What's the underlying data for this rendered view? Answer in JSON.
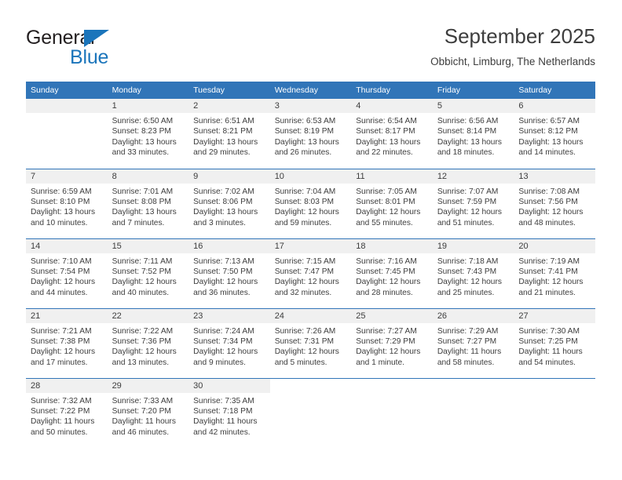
{
  "brand": {
    "name_dark": "General",
    "name_blue": "Blue",
    "accent_color": "#1b75bb"
  },
  "header": {
    "title": "September 2025",
    "subtitle": "Obbicht, Limburg, The Netherlands"
  },
  "theme": {
    "header_row_bg": "#3175b8",
    "daynum_bg": "#f0f0f0",
    "text_color": "#3d3d3d",
    "week_divider": "#3175b8"
  },
  "weekdays": [
    "Sunday",
    "Monday",
    "Tuesday",
    "Wednesday",
    "Thursday",
    "Friday",
    "Saturday"
  ],
  "weeks": [
    [
      {
        "day": "",
        "sunrise": "",
        "sunset": "",
        "daylight_1": "",
        "daylight_2": ""
      },
      {
        "day": "1",
        "sunrise": "Sunrise: 6:50 AM",
        "sunset": "Sunset: 8:23 PM",
        "daylight_1": "Daylight: 13 hours",
        "daylight_2": "and 33 minutes."
      },
      {
        "day": "2",
        "sunrise": "Sunrise: 6:51 AM",
        "sunset": "Sunset: 8:21 PM",
        "daylight_1": "Daylight: 13 hours",
        "daylight_2": "and 29 minutes."
      },
      {
        "day": "3",
        "sunrise": "Sunrise: 6:53 AM",
        "sunset": "Sunset: 8:19 PM",
        "daylight_1": "Daylight: 13 hours",
        "daylight_2": "and 26 minutes."
      },
      {
        "day": "4",
        "sunrise": "Sunrise: 6:54 AM",
        "sunset": "Sunset: 8:17 PM",
        "daylight_1": "Daylight: 13 hours",
        "daylight_2": "and 22 minutes."
      },
      {
        "day": "5",
        "sunrise": "Sunrise: 6:56 AM",
        "sunset": "Sunset: 8:14 PM",
        "daylight_1": "Daylight: 13 hours",
        "daylight_2": "and 18 minutes."
      },
      {
        "day": "6",
        "sunrise": "Sunrise: 6:57 AM",
        "sunset": "Sunset: 8:12 PM",
        "daylight_1": "Daylight: 13 hours",
        "daylight_2": "and 14 minutes."
      }
    ],
    [
      {
        "day": "7",
        "sunrise": "Sunrise: 6:59 AM",
        "sunset": "Sunset: 8:10 PM",
        "daylight_1": "Daylight: 13 hours",
        "daylight_2": "and 10 minutes."
      },
      {
        "day": "8",
        "sunrise": "Sunrise: 7:01 AM",
        "sunset": "Sunset: 8:08 PM",
        "daylight_1": "Daylight: 13 hours",
        "daylight_2": "and 7 minutes."
      },
      {
        "day": "9",
        "sunrise": "Sunrise: 7:02 AM",
        "sunset": "Sunset: 8:06 PM",
        "daylight_1": "Daylight: 13 hours",
        "daylight_2": "and 3 minutes."
      },
      {
        "day": "10",
        "sunrise": "Sunrise: 7:04 AM",
        "sunset": "Sunset: 8:03 PM",
        "daylight_1": "Daylight: 12 hours",
        "daylight_2": "and 59 minutes."
      },
      {
        "day": "11",
        "sunrise": "Sunrise: 7:05 AM",
        "sunset": "Sunset: 8:01 PM",
        "daylight_1": "Daylight: 12 hours",
        "daylight_2": "and 55 minutes."
      },
      {
        "day": "12",
        "sunrise": "Sunrise: 7:07 AM",
        "sunset": "Sunset: 7:59 PM",
        "daylight_1": "Daylight: 12 hours",
        "daylight_2": "and 51 minutes."
      },
      {
        "day": "13",
        "sunrise": "Sunrise: 7:08 AM",
        "sunset": "Sunset: 7:56 PM",
        "daylight_1": "Daylight: 12 hours",
        "daylight_2": "and 48 minutes."
      }
    ],
    [
      {
        "day": "14",
        "sunrise": "Sunrise: 7:10 AM",
        "sunset": "Sunset: 7:54 PM",
        "daylight_1": "Daylight: 12 hours",
        "daylight_2": "and 44 minutes."
      },
      {
        "day": "15",
        "sunrise": "Sunrise: 7:11 AM",
        "sunset": "Sunset: 7:52 PM",
        "daylight_1": "Daylight: 12 hours",
        "daylight_2": "and 40 minutes."
      },
      {
        "day": "16",
        "sunrise": "Sunrise: 7:13 AM",
        "sunset": "Sunset: 7:50 PM",
        "daylight_1": "Daylight: 12 hours",
        "daylight_2": "and 36 minutes."
      },
      {
        "day": "17",
        "sunrise": "Sunrise: 7:15 AM",
        "sunset": "Sunset: 7:47 PM",
        "daylight_1": "Daylight: 12 hours",
        "daylight_2": "and 32 minutes."
      },
      {
        "day": "18",
        "sunrise": "Sunrise: 7:16 AM",
        "sunset": "Sunset: 7:45 PM",
        "daylight_1": "Daylight: 12 hours",
        "daylight_2": "and 28 minutes."
      },
      {
        "day": "19",
        "sunrise": "Sunrise: 7:18 AM",
        "sunset": "Sunset: 7:43 PM",
        "daylight_1": "Daylight: 12 hours",
        "daylight_2": "and 25 minutes."
      },
      {
        "day": "20",
        "sunrise": "Sunrise: 7:19 AM",
        "sunset": "Sunset: 7:41 PM",
        "daylight_1": "Daylight: 12 hours",
        "daylight_2": "and 21 minutes."
      }
    ],
    [
      {
        "day": "21",
        "sunrise": "Sunrise: 7:21 AM",
        "sunset": "Sunset: 7:38 PM",
        "daylight_1": "Daylight: 12 hours",
        "daylight_2": "and 17 minutes."
      },
      {
        "day": "22",
        "sunrise": "Sunrise: 7:22 AM",
        "sunset": "Sunset: 7:36 PM",
        "daylight_1": "Daylight: 12 hours",
        "daylight_2": "and 13 minutes."
      },
      {
        "day": "23",
        "sunrise": "Sunrise: 7:24 AM",
        "sunset": "Sunset: 7:34 PM",
        "daylight_1": "Daylight: 12 hours",
        "daylight_2": "and 9 minutes."
      },
      {
        "day": "24",
        "sunrise": "Sunrise: 7:26 AM",
        "sunset": "Sunset: 7:31 PM",
        "daylight_1": "Daylight: 12 hours",
        "daylight_2": "and 5 minutes."
      },
      {
        "day": "25",
        "sunrise": "Sunrise: 7:27 AM",
        "sunset": "Sunset: 7:29 PM",
        "daylight_1": "Daylight: 12 hours",
        "daylight_2": "and 1 minute."
      },
      {
        "day": "26",
        "sunrise": "Sunrise: 7:29 AM",
        "sunset": "Sunset: 7:27 PM",
        "daylight_1": "Daylight: 11 hours",
        "daylight_2": "and 58 minutes."
      },
      {
        "day": "27",
        "sunrise": "Sunrise: 7:30 AM",
        "sunset": "Sunset: 7:25 PM",
        "daylight_1": "Daylight: 11 hours",
        "daylight_2": "and 54 minutes."
      }
    ],
    [
      {
        "day": "28",
        "sunrise": "Sunrise: 7:32 AM",
        "sunset": "Sunset: 7:22 PM",
        "daylight_1": "Daylight: 11 hours",
        "daylight_2": "and 50 minutes."
      },
      {
        "day": "29",
        "sunrise": "Sunrise: 7:33 AM",
        "sunset": "Sunset: 7:20 PM",
        "daylight_1": "Daylight: 11 hours",
        "daylight_2": "and 46 minutes."
      },
      {
        "day": "30",
        "sunrise": "Sunrise: 7:35 AM",
        "sunset": "Sunset: 7:18 PM",
        "daylight_1": "Daylight: 11 hours",
        "daylight_2": "and 42 minutes."
      },
      {
        "day": "",
        "sunrise": "",
        "sunset": "",
        "daylight_1": "",
        "daylight_2": ""
      },
      {
        "day": "",
        "sunrise": "",
        "sunset": "",
        "daylight_1": "",
        "daylight_2": ""
      },
      {
        "day": "",
        "sunrise": "",
        "sunset": "",
        "daylight_1": "",
        "daylight_2": ""
      },
      {
        "day": "",
        "sunrise": "",
        "sunset": "",
        "daylight_1": "",
        "daylight_2": ""
      }
    ]
  ]
}
